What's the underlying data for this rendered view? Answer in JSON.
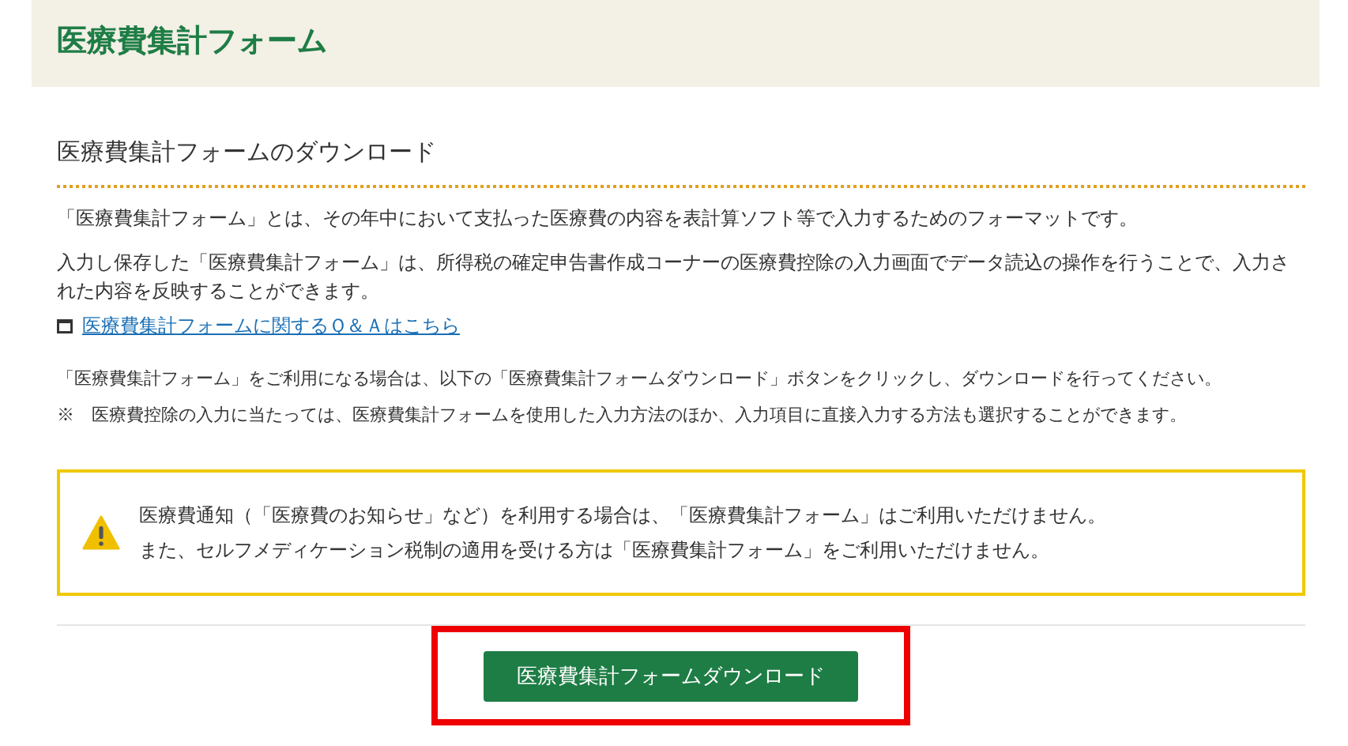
{
  "page_title": "医療費集計フォーム",
  "section_heading": "医療費集計フォームのダウンロード",
  "intro_paragraphs": [
    "「医療費集計フォーム」とは、その年中において支払った医療費の内容を表計算ソフト等で入力するためのフォーマットです。",
    "入力し保存した「医療費集計フォーム」は、所得税の確定申告書作成コーナーの医療費控除の入力画面でデータ読込の操作を行うことで、入力された内容を反映することができます。"
  ],
  "faq_link": "医療費集計フォームに関するＱ＆Ａはこちら",
  "instructions": [
    "「医療費集計フォーム」をご利用になる場合は、以下の「医療費集計フォームダウンロード」ボタンをクリックし、ダウンロードを行ってください。",
    "※　医療費控除の入力に当たっては、医療費集計フォームを使用した入力方法のほか、入力項目に直接入力する方法も選択することができます。"
  ],
  "warning": {
    "lines": [
      "医療費通知（「医療費のお知らせ」など）を利用する場合は、「医療費集計フォーム」はご利用いただけません。",
      "また、セルフメディケーション税制の適用を受ける方は「医療費集計フォーム」をご利用いただけません。"
    ]
  },
  "download_button": {
    "label": "医療費集計フォームダウンロード",
    "highlighted": true
  }
}
